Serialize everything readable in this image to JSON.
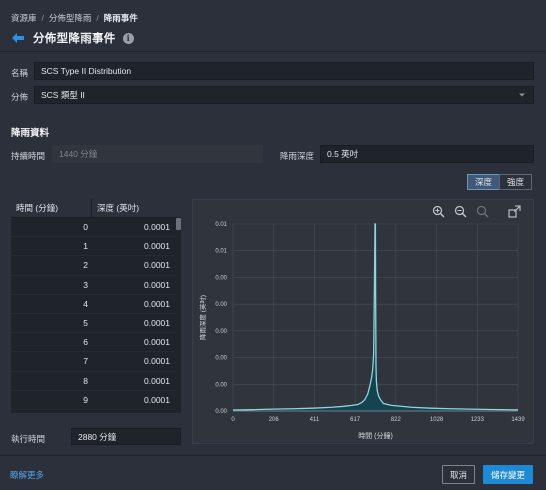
{
  "breadcrumb": {
    "items": [
      "資源庫",
      "分佈型降雨",
      "降雨事件"
    ],
    "separator": "/"
  },
  "header": {
    "title": "分佈型降雨事件"
  },
  "form": {
    "name_label": "名稱",
    "name_value": "SCS Type II Distribution",
    "distribution_label": "分佈",
    "distribution_value": "SCS 類型 II"
  },
  "rainfall": {
    "section_title": "降雨資料",
    "duration_label": "持續時間",
    "duration_placeholder": "1440 分鐘",
    "depth_label": "降雨深度",
    "depth_value": "0.5 英吋"
  },
  "toggle": {
    "depth_label": "深度",
    "intensity_label": "強度",
    "active": "depth"
  },
  "table": {
    "headers": [
      "時間 (分鐘)",
      "深度 (英吋)"
    ],
    "rows": [
      [
        "0",
        "0.0001"
      ],
      [
        "1",
        "0.0001"
      ],
      [
        "2",
        "0.0001"
      ],
      [
        "3",
        "0.0001"
      ],
      [
        "4",
        "0.0001"
      ],
      [
        "5",
        "0.0001"
      ],
      [
        "6",
        "0.0001"
      ],
      [
        "7",
        "0.0001"
      ],
      [
        "8",
        "0.0001"
      ],
      [
        "9",
        "0.0001"
      ]
    ]
  },
  "run_time": {
    "label": "執行時間",
    "value": "2880 分鐘"
  },
  "footer": {
    "learn_more": "瞭解更多",
    "cancel_label": "取消",
    "save_label": "儲存變更"
  },
  "colors": {
    "accent": "#1e8ad6",
    "series": "#8fd3dc",
    "link": "#5aa3e8"
  },
  "chart_data": {
    "type": "area",
    "xlabel": "時間 (分鐘)",
    "ylabel": "降雨深度 (英吋)",
    "xlim": [
      0,
      1439
    ],
    "ylim": [
      0,
      0.01
    ],
    "xticks": [
      "0",
      "206",
      "411",
      "617",
      "822",
      "1028",
      "1233",
      "1439"
    ],
    "yticks": [
      "0.00",
      "0.00",
      "0.00",
      "0.00",
      "0.00",
      "0.00",
      "0.01",
      "0.01"
    ],
    "grid": true,
    "series": [
      {
        "x": [
          0,
          100,
          200,
          300,
          400,
          500,
          560,
          600,
          630,
          650,
          665,
          680,
          690,
          700,
          705,
          710,
          714,
          717,
          719,
          720,
          721,
          722,
          724,
          728,
          735,
          745,
          760,
          800,
          900,
          1000,
          1100,
          1200,
          1300,
          1439
        ],
        "values": [
          5e-05,
          7e-05,
          0.0001,
          0.00012,
          0.00015,
          0.0002,
          0.00025,
          0.0003,
          0.00035,
          0.00045,
          0.0006,
          0.0009,
          0.0013,
          0.0018,
          0.0022,
          0.003,
          0.0065,
          0.01,
          0.01,
          0.0068,
          0.0045,
          0.0024,
          0.0016,
          0.0011,
          0.0008,
          0.0006,
          0.0004,
          0.0003,
          0.0002,
          0.00015,
          0.00012,
          0.0001,
          8e-05,
          6e-05
        ]
      }
    ]
  }
}
